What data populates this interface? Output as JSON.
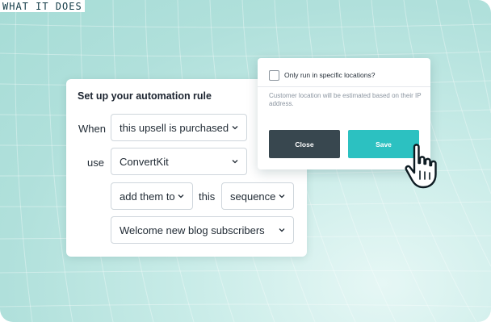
{
  "header": {
    "label": "WHAT IT DOES"
  },
  "rule": {
    "title": "Set up your automation rule",
    "when_label": "When",
    "when_value": "this upsell is purchased",
    "use_label": "use",
    "use_value": "ConvertKit",
    "action_value": "add them to",
    "this_label": "this",
    "target_value": "sequence",
    "sequence_value": "Welcome new blog subscribers"
  },
  "location": {
    "checkbox_label": "Only run in specific locations?",
    "checked": false,
    "hint": "Customer location will be estimated based on their IP address.",
    "close_label": "Close",
    "save_label": "Save"
  },
  "colors": {
    "save": "#2cc1c1",
    "close": "#38474f",
    "background": "#b0e0db"
  }
}
